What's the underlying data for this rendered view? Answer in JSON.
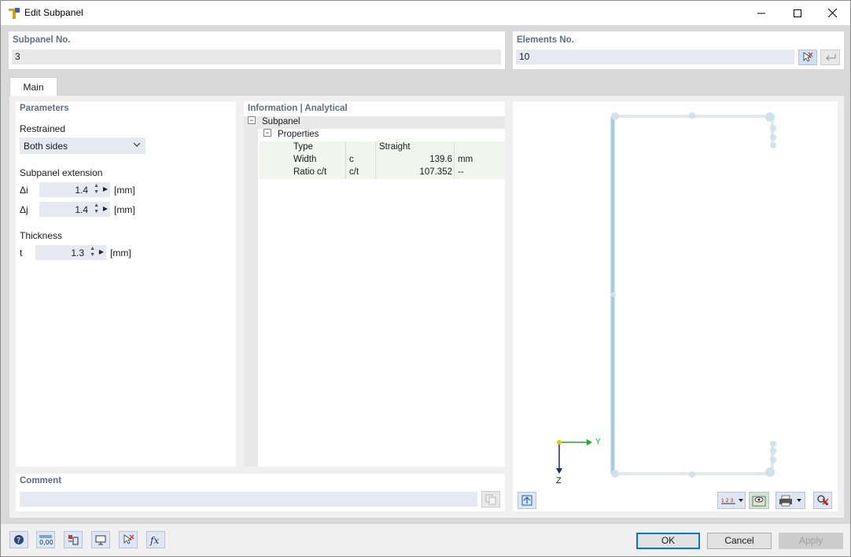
{
  "window": {
    "title": "Edit Subpanel"
  },
  "subpanel_no": {
    "label": "Subpanel No.",
    "value": "3"
  },
  "elements_no": {
    "label": "Elements No.",
    "value": "10"
  },
  "tabs": [
    {
      "label": "Main"
    }
  ],
  "parameters": {
    "title": "Parameters",
    "restrained_label": "Restrained",
    "restrained_value": "Both sides",
    "extension_label": "Subpanel extension",
    "di_label": "Δi",
    "di_value": "1.4",
    "di_unit": "[mm]",
    "dj_label": "Δj",
    "dj_value": "1.4",
    "dj_unit": "[mm]",
    "thickness_label": "Thickness",
    "t_label": "t",
    "t_value": "1.3",
    "t_unit": "[mm]"
  },
  "information": {
    "title": "Information | Analytical",
    "root": "Subpanel",
    "node": "Properties",
    "rows": [
      {
        "name": "Type",
        "symbol": "",
        "value": "Straight",
        "unit": ""
      },
      {
        "name": "Width",
        "symbol": "c",
        "value": "139.6",
        "unit": "mm"
      },
      {
        "name": "Ratio c/t",
        "symbol": "c/t",
        "value": "107.352",
        "unit": "--"
      }
    ]
  },
  "comment": {
    "label": "Comment",
    "value": ""
  },
  "preview": {
    "axis_y": "Y",
    "axis_z": "Z"
  },
  "buttons": {
    "ok": "OK",
    "cancel": "Cancel",
    "apply": "Apply"
  },
  "colors": {
    "accent_blue": "#5a6e8c",
    "section_line": "#a8cbe8",
    "focus": "#0078d7"
  }
}
